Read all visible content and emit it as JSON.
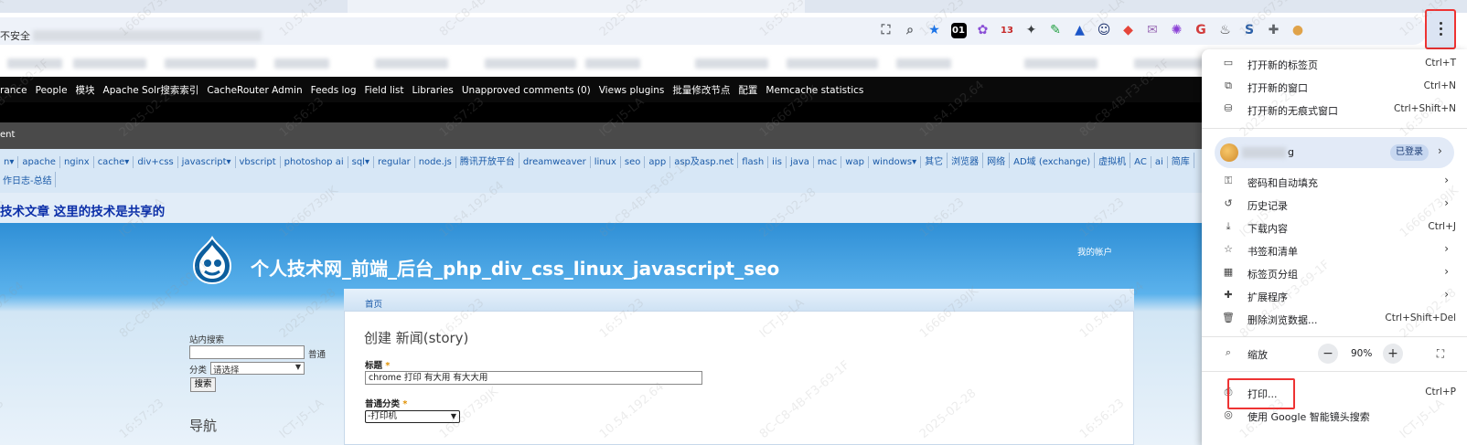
{
  "browser": {
    "security_label": "不安全",
    "extensions": [
      {
        "icon": "translate-icon",
        "glyph": "⛶",
        "color": "#5f6368"
      },
      {
        "icon": "zoom-icon",
        "glyph": "⌕",
        "color": "#5f6368"
      },
      {
        "icon": "bookmark-star-icon",
        "glyph": "★",
        "color": "#1a73e8"
      },
      {
        "icon": "ext-01-icon",
        "glyph": "01",
        "color": "#000000"
      },
      {
        "icon": "ext-brain-icon",
        "glyph": "✿",
        "color": "#8a4fd6"
      },
      {
        "icon": "ext-calendar-icon",
        "glyph": "13",
        "color": "#c62828"
      },
      {
        "icon": "ext-sparkle-icon",
        "glyph": "✦",
        "color": "#3c4043"
      },
      {
        "icon": "ext-green-icon",
        "glyph": "✎",
        "color": "#1e9e3e"
      },
      {
        "icon": "ext-triangle-icon",
        "glyph": "▲",
        "color": "#1a55c9"
      },
      {
        "icon": "ext-face-icon",
        "glyph": "☺",
        "color": "#1a2f6b"
      },
      {
        "icon": "ext-red-icon",
        "glyph": "◆",
        "color": "#e5453a"
      },
      {
        "icon": "ext-mail-icon",
        "glyph": "✉",
        "color": "#9a6bb5"
      },
      {
        "icon": "ext-gear-icon",
        "glyph": "✺",
        "color": "#8a3fd6"
      },
      {
        "icon": "ext-g-icon",
        "glyph": "G",
        "color": "#d23b3b"
      },
      {
        "icon": "ext-cake-icon",
        "glyph": "♨",
        "color": "#444444"
      },
      {
        "icon": "ext-s-icon",
        "glyph": "S",
        "color": "#2a5fa8"
      },
      {
        "icon": "extensions-puzzle-icon",
        "glyph": "✚",
        "color": "#5f6368"
      },
      {
        "icon": "profile-avatar-icon",
        "glyph": "●",
        "color": "#e0a34a"
      }
    ]
  },
  "adminbar": {
    "items": [
      "rance",
      "People",
      "模块",
      "Apache Solr搜索索引",
      "CacheRouter Admin",
      "Feeds log",
      "Field list",
      "Libraries",
      "Unapproved comments (0)",
      "Views plugins",
      "批量修改节点",
      "配置",
      "Memcache statistics"
    ]
  },
  "greybar": {
    "label": "ent"
  },
  "categories": {
    "row1": [
      "n▾",
      "apache",
      "nginx",
      "cache▾",
      "div+css",
      "javascript▾",
      "vbscript",
      "photoshop ai",
      "sql▾",
      "regular",
      "node.js",
      "腾讯开放平台",
      "dreamweaver",
      "linux",
      "seo",
      "app",
      "asp及asp.net",
      "flash",
      "iis",
      "java",
      "mac",
      "wap",
      "windows▾",
      "其它",
      "浏览器",
      "网络",
      "AD域 (exchange)",
      "虚拟机",
      "AC",
      "ai",
      "简库"
    ],
    "row2": "作日志-总结"
  },
  "site": {
    "slogan": "技术文章 这里的技术是共享的",
    "title": "个人技术网_前端_后台_php_div_css_linux_javascript_seo",
    "my_account": "我的帐户"
  },
  "sidebar": {
    "search_label": "站内搜索",
    "normal_label": "普通",
    "category_label": "分类",
    "category_value": "请选择",
    "search_button": "搜索",
    "nav_heading": "导航"
  },
  "form": {
    "breadcrumb": "首页",
    "page_title": "创建 新闻(story)",
    "title_label": "标题",
    "required_mark": "*",
    "title_value": "chrome 打印 有大用 有大大用",
    "normal_category_label": "普通分类",
    "type_value": "-打印机"
  },
  "menu": {
    "new_tab": "打开新的标签页",
    "new_tab_sc": "Ctrl+T",
    "new_window": "打开新的窗口",
    "new_window_sc": "Ctrl+N",
    "incognito": "打开新的无痕式窗口",
    "incognito_sc": "Ctrl+Shift+N",
    "profile_name_suffix": "g",
    "signed_in": "已登录",
    "passwords": "密码和自动填充",
    "history": "历史记录",
    "downloads": "下载内容",
    "downloads_sc": "Ctrl+J",
    "bookmarks": "书签和清单",
    "tab_groups": "标签页分组",
    "extensions": "扩展程序",
    "clear_data": "删除浏览数据...",
    "clear_data_sc": "Ctrl+Shift+Del",
    "zoom": "缩放",
    "zoom_minus": "−",
    "zoom_value": "90%",
    "zoom_plus": "+",
    "print": "打印...",
    "print_sc": "Ctrl+P",
    "lens": "使用 Google 智能镜头搜索"
  },
  "watermark": {
    "lines": [
      "ICT-J5-LA",
      "16666739JK",
      "10.54.192.64",
      "8C-C8-4B-F3-69-1F",
      "2025-02-28",
      "16:56:23",
      "16:57:23"
    ]
  }
}
